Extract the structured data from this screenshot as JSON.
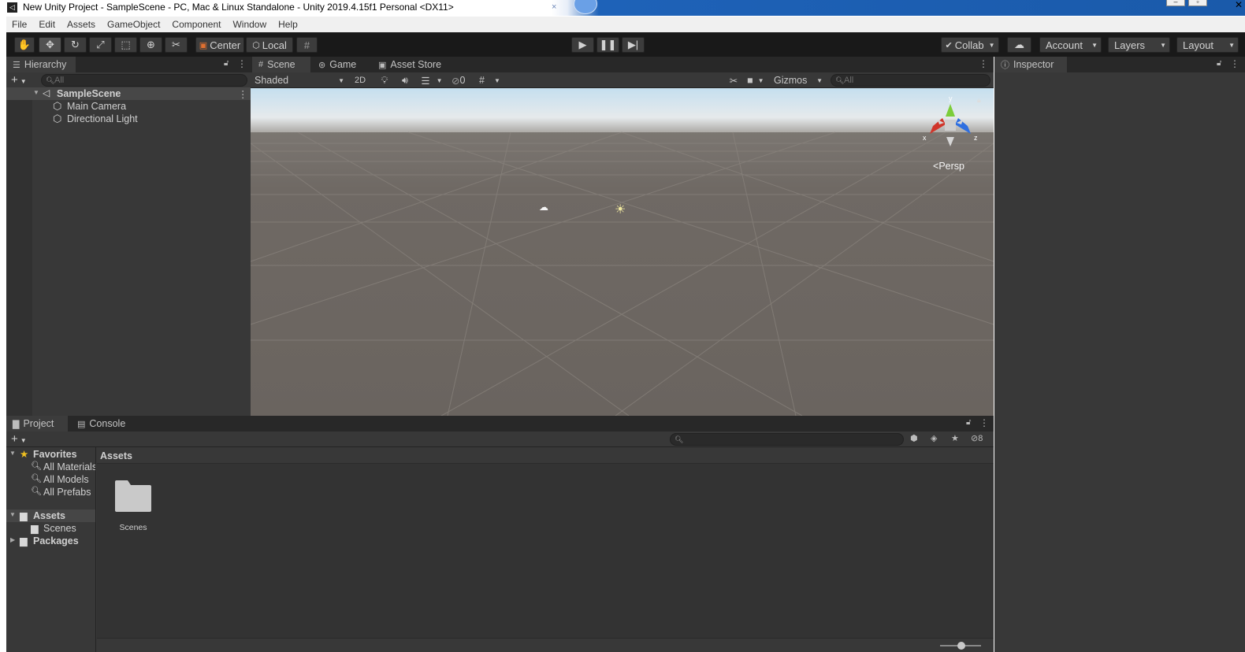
{
  "window": {
    "title": "New Unity Project - SampleScene - PC, Mac & Linux Standalone - Unity 2019.4.15f1 Personal <DX11>",
    "close": "✕"
  },
  "menu": [
    "File",
    "Edit",
    "Assets",
    "GameObject",
    "Component",
    "Window",
    "Help"
  ],
  "toolbar": {
    "pivot_label": "Center",
    "space_label": "Local",
    "collab_label": "Collab",
    "account_label": "Account",
    "layers_label": "Layers",
    "layout_label": "Layout"
  },
  "hierarchy": {
    "tab": "Hierarchy",
    "search_placeholder": "All",
    "scene": "SampleScene",
    "objects": [
      "Main Camera",
      "Directional Light"
    ]
  },
  "scene_view": {
    "tabs": [
      "Scene",
      "Game",
      "Asset Store"
    ],
    "draw_mode": "Shaded",
    "mode_2d": "2D",
    "hidden_count": "0",
    "gizmos_label": "Gizmos",
    "search_placeholder": "All",
    "gizmo_axes": {
      "x": "x",
      "y": "y",
      "z": "z"
    },
    "projection_label": "Persp"
  },
  "project": {
    "tabs": [
      "Project",
      "Console"
    ],
    "hidden_count": "8",
    "favorites": {
      "label": "Favorites",
      "items": [
        "All Materials",
        "All Models",
        "All Prefabs"
      ]
    },
    "assets": {
      "label": "Assets",
      "children": [
        "Scenes"
      ]
    },
    "packages": {
      "label": "Packages"
    },
    "breadcrumb": "Assets",
    "grid_items": [
      {
        "name": "Scenes",
        "icon": "folder-icon"
      }
    ]
  },
  "inspector": {
    "tab": "Inspector"
  },
  "colors": {
    "toolbar_bg": "#191919",
    "panel_bg": "#383838",
    "viewport_ground": "#6e6863",
    "axis_x": "#d0352a",
    "axis_y": "#7ccd3a",
    "axis_z": "#2f6fe0"
  }
}
